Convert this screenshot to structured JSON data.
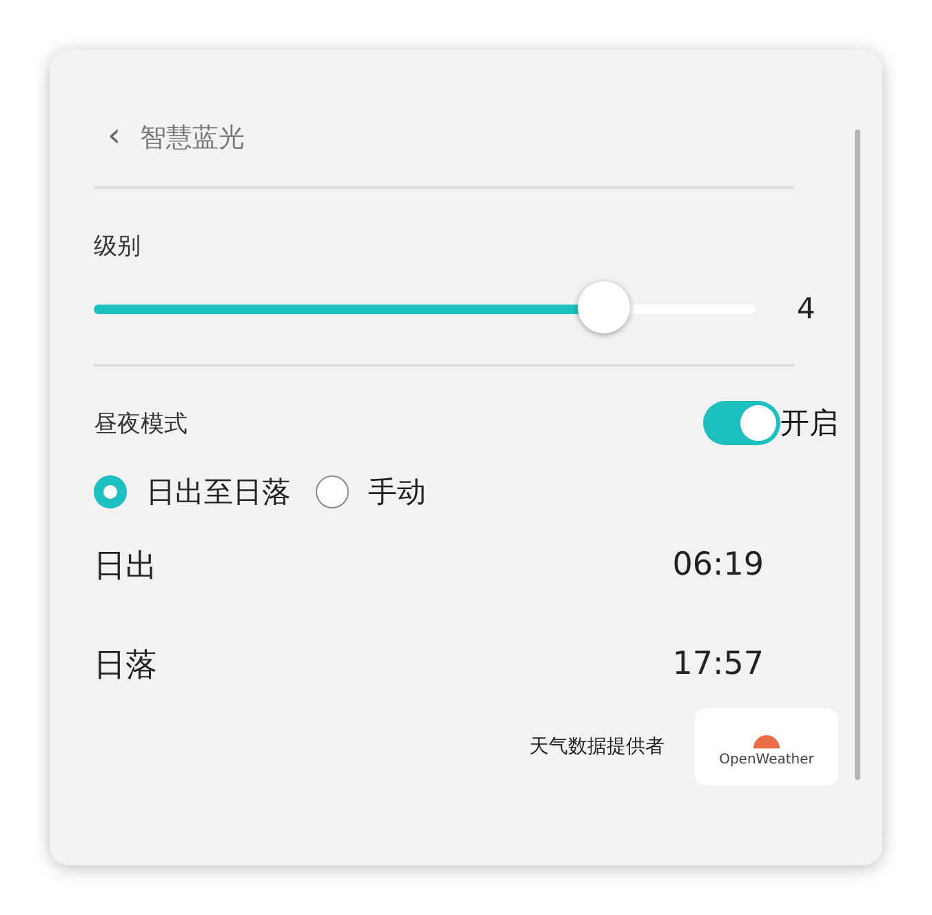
{
  "header": {
    "back_icon": "‹",
    "title": "智慧蓝光"
  },
  "level_section": {
    "label": "级别",
    "slider": {
      "level": 0.77
    },
    "reading": "4"
  },
  "day_night": {
    "label": "昼夜模式",
    "toggle": {
      "on": true
    },
    "toggle_label": "开启",
    "modes": [
      {
        "label": "日出至日落",
        "selected": true
      },
      {
        "label": "手动",
        "selected": false
      }
    ],
    "times": [
      {
        "label": "日出",
        "value": "06:19"
      },
      {
        "label": "日落",
        "value": "17:57"
      }
    ]
  },
  "provider": {
    "label": "天气数据提供者",
    "logo_text": "OpenWeather"
  }
}
